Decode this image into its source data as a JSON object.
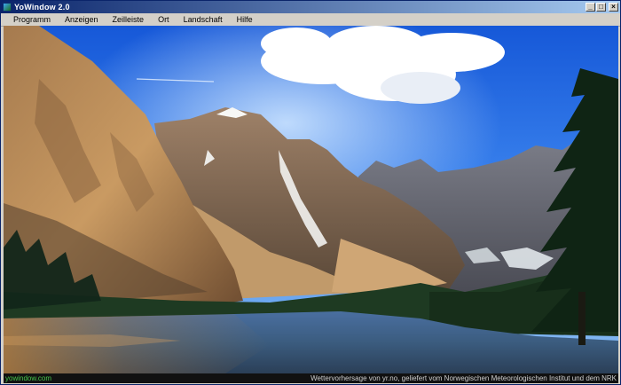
{
  "window": {
    "title": "YoWindow 2.0",
    "buttons": {
      "minimize": "_",
      "maximize": "□",
      "close": "×"
    }
  },
  "menubar": {
    "items": [
      "Programm",
      "Anzeigen",
      "Zeilleiste",
      "Ort",
      "Landschaft",
      "Hilfe"
    ]
  },
  "status": {
    "left": "yowindow.com",
    "right": "Wettervorhersage von yr.no, geliefert vom Norwegischen Meteorologischen Institut und dem NRK"
  },
  "colors": {
    "titlebar_start": "#0a246a",
    "titlebar_end": "#a6caf0",
    "status_link": "#45c84b"
  },
  "scene": {
    "description_icons": [
      "mountain-illustration",
      "cloud-icon",
      "tree-icon",
      "lake-reflection"
    ]
  }
}
